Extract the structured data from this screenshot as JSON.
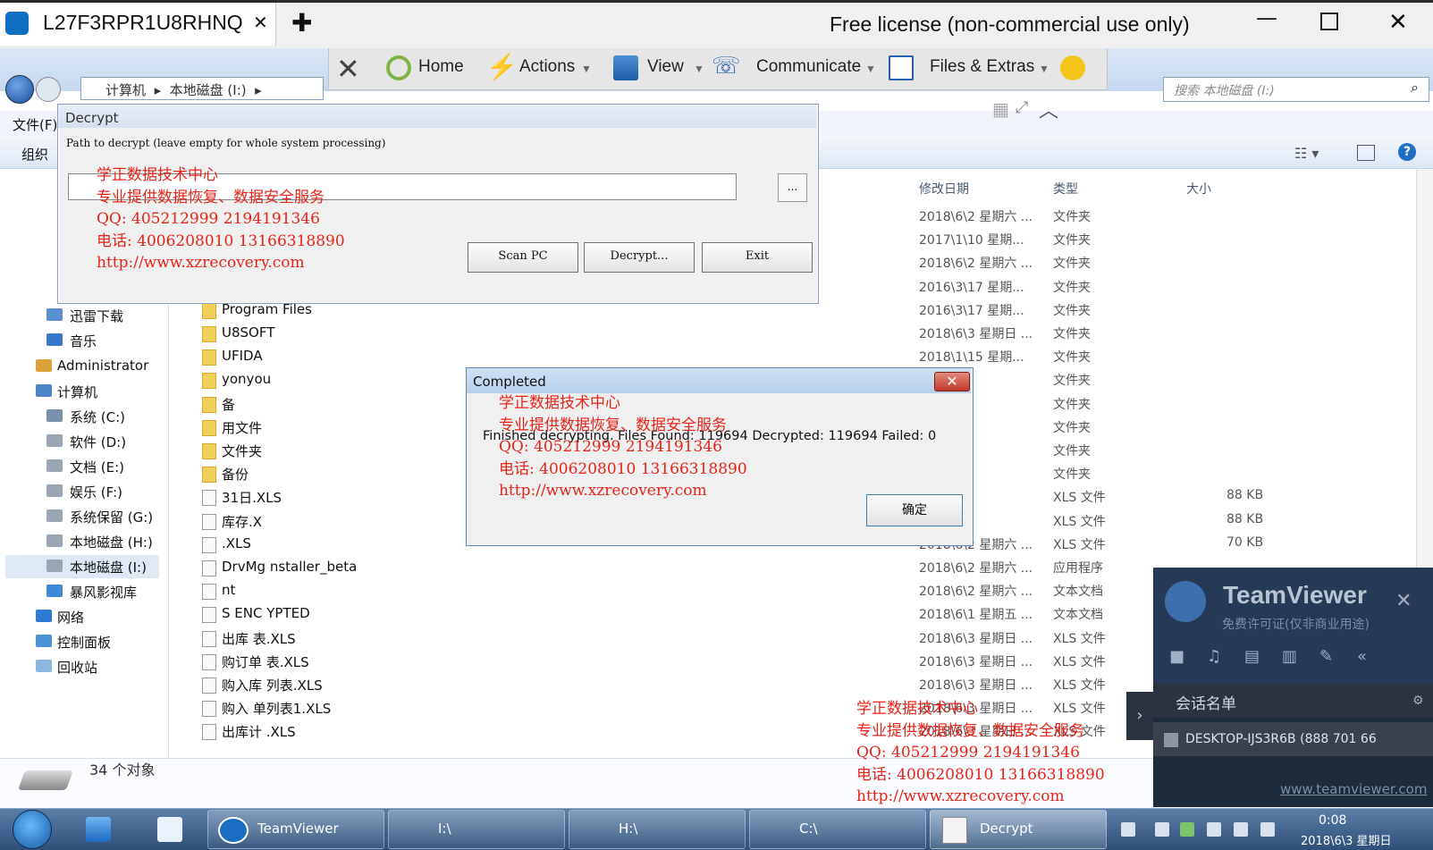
{
  "tv": {
    "tab_title": "L27F3RPR1U8RHNQ",
    "tab_close": "✕",
    "new_tab": "✚",
    "license": "Free license (non-commercial use only)",
    "win_min": "—",
    "win_close": "✕",
    "toolbar": {
      "close": "✕",
      "home": "Home",
      "actions": "Actions",
      "view": "View",
      "communicate": "Communicate",
      "files_extras": "Files & Extras"
    }
  },
  "explorer": {
    "breadcrumb": [
      "计算机",
      "本地磁盘 (I:)"
    ],
    "search_placeholder": "搜索 本地磁盘 (I:)",
    "menu_file": "文件(F)",
    "organize": "组织",
    "columns": {
      "date": "修改日期",
      "type": "类型",
      "size": "大小"
    },
    "nav": [
      "迅雷下载",
      "音乐",
      "Administrator",
      "计算机",
      "系统 (C:)",
      "软件 (D:)",
      "文档 (E:)",
      "娱乐 (F:)",
      "系统保留 (G:)",
      "本地磁盘 (H:)",
      "本地磁盘 (I:)",
      "暴风影视库",
      "网络",
      "控制面板",
      "回收站"
    ],
    "rows": [
      {
        "name": "",
        "date": "2018\\6\\2 星期六 ...",
        "type": "文件夹",
        "size": ""
      },
      {
        "name": "",
        "date": "2017\\1\\10 星期...",
        "type": "文件夹",
        "size": ""
      },
      {
        "name": "",
        "date": "2018\\6\\2 星期六 ...",
        "type": "文件夹",
        "size": ""
      },
      {
        "name": "",
        "date": "2016\\3\\17 星期...",
        "type": "文件夹",
        "size": ""
      },
      {
        "name": "Program Files",
        "date": "2016\\3\\17 星期...",
        "type": "文件夹",
        "size": ""
      },
      {
        "name": "U8SOFT",
        "date": "2018\\6\\3 星期日 ...",
        "type": "文件夹",
        "size": ""
      },
      {
        "name": "UFIDA",
        "date": "2018\\1\\15 星期...",
        "type": "文件夹",
        "size": ""
      },
      {
        "name": "yonyou",
        "date": "",
        "type": "文件夹",
        "size": ""
      },
      {
        "name": "备",
        "date": "",
        "type": "文件夹",
        "size": ""
      },
      {
        "name": "用文件",
        "date": "",
        "type": "文件夹",
        "size": ""
      },
      {
        "name": "文件夹",
        "date": "",
        "type": "文件夹",
        "size": ""
      },
      {
        "name": "备份",
        "date": "",
        "type": "文件夹",
        "size": ""
      },
      {
        "name": "31日.XLS",
        "date": "",
        "type": "XLS 文件",
        "size": "88 KB"
      },
      {
        "name": "库存.X",
        "date": "",
        "type": "XLS 文件",
        "size": "88 KB"
      },
      {
        "name": ".XLS",
        "date": "2018\\6\\2 星期六 ...",
        "type": "XLS 文件",
        "size": "70 KB"
      },
      {
        "name": "DrvMg  nstaller_beta",
        "date": "2018\\6\\2 星期六 ...",
        "type": "应用程序",
        "size": ""
      },
      {
        "name": "nt",
        "date": "2018\\6\\2 星期六 ...",
        "type": "文本文档",
        "size": ""
      },
      {
        "name": "S ENC  YPTED",
        "date": "2018\\6\\1 星期五 ...",
        "type": "文本文档",
        "size": ""
      },
      {
        "name": "出库  表.XLS",
        "date": "2018\\6\\3 星期日 ...",
        "type": "XLS 文件",
        "size": ""
      },
      {
        "name": "购订单  表.XLS",
        "date": "2018\\6\\3 星期日 ...",
        "type": "XLS 文件",
        "size": ""
      },
      {
        "name": "购入库  列表.XLS",
        "date": "2018\\6\\3 星期日 ...",
        "type": "XLS 文件",
        "size": ""
      },
      {
        "name": "购入  单列表1.XLS",
        "date": "2018\\6\\3 星期日 ...",
        "type": "XLS 文件",
        "size": ""
      },
      {
        "name": "出库计  .XLS",
        "date": "2018\\6\\3 星期日 ...",
        "type": "XLS 文件",
        "size": ""
      }
    ],
    "status": "34 个对象"
  },
  "decrypt": {
    "title": "Decrypt",
    "prompt": "Path to decrypt (leave empty for whole system processing)",
    "browse": "...",
    "scan": "Scan PC",
    "decrypt": "Decrypt...",
    "exit": "Exit"
  },
  "completed": {
    "title": "Completed",
    "message": "Finished decrypting. Files Found: 119694 Decrypted: 119694 Failed: 0",
    "ok": "确定"
  },
  "watermark": {
    "line1": "学正数据技术中心",
    "line2": "专业提供数据恢复、数据安全服务",
    "line3": "QQ: 405212999 2194191346",
    "line4": "电话: 4006208010 13166318890",
    "line5": "http://www.xzrecovery.com"
  },
  "tv_panel": {
    "name": "TeamViewer",
    "sub": "免费许可证(仅非商业用途)",
    "session_title": "会话名单",
    "session_item": "DESKTOP-IJS3R6B (888 701 66",
    "link": "www.teamviewer.com"
  },
  "taskbar": {
    "items": [
      "TeamViewer",
      "I:\\",
      "H:\\",
      "C:\\",
      "Decrypt"
    ],
    "time": "0:08",
    "date": "2018\\6\\3 星期日"
  },
  "colors": {
    "watermark": "#e8241a",
    "tv_blue": "#0e6fc2",
    "panel_dark": "#1e2b3b"
  }
}
